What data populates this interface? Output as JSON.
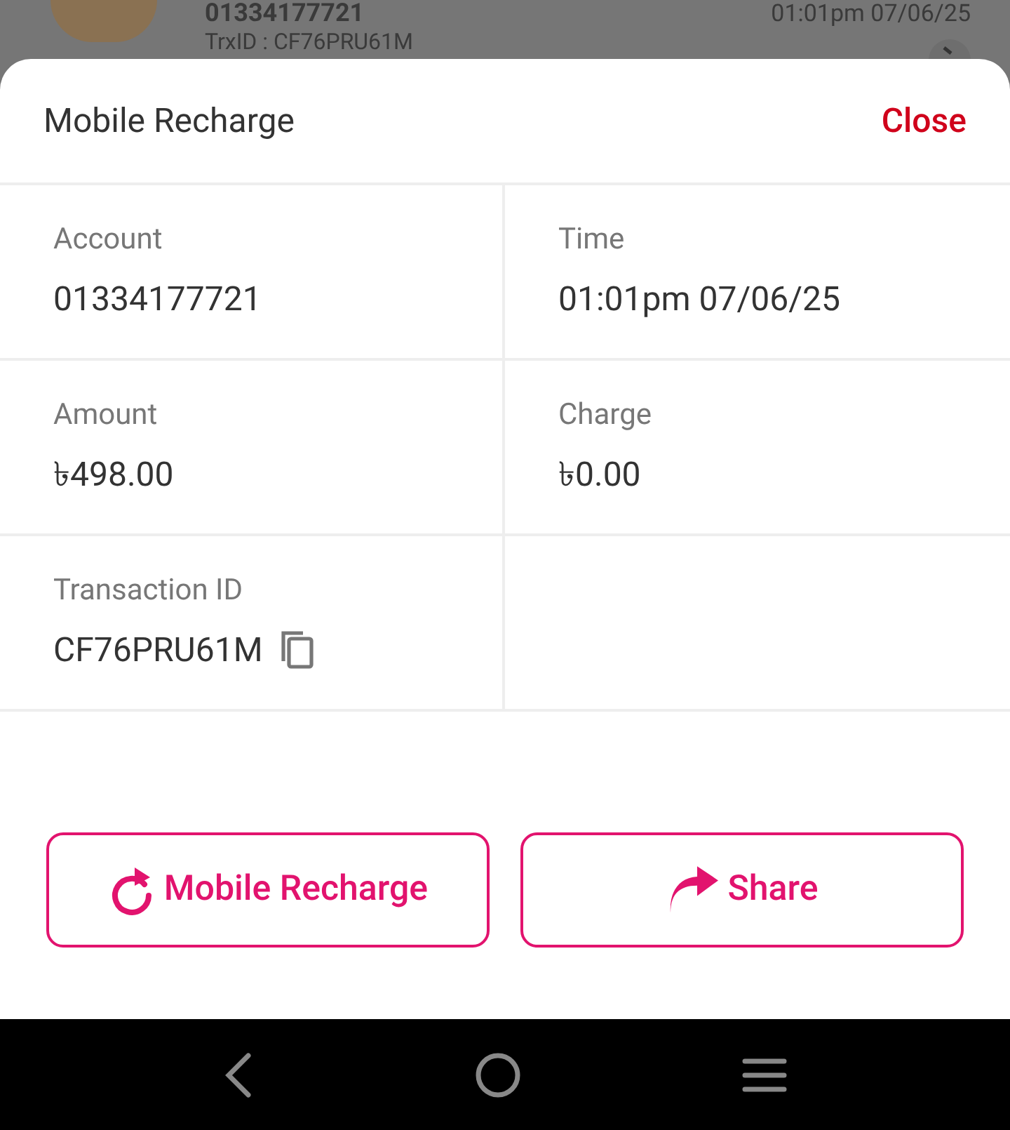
{
  "background_item": {
    "account": "01334177721",
    "time": "01:01pm 07/06/25",
    "trx_id": "TrxID : CF76PRU61M"
  },
  "sheet": {
    "title": "Mobile Recharge",
    "close": "Close"
  },
  "fields": [
    {
      "label": "Account",
      "value": "01334177721",
      "copyable": false
    },
    {
      "label": "Time",
      "value": "01:01pm 07/06/25",
      "copyable": false
    },
    {
      "label": "Amount",
      "value": "৳498.00",
      "copyable": false
    },
    {
      "label": "Charge",
      "value": "৳0.00",
      "copyable": false
    },
    {
      "label": "Transaction ID",
      "value": "CF76PRU61M",
      "copyable": true
    }
  ],
  "actions": [
    {
      "kind": "repeat",
      "label": "Mobile Recharge"
    },
    {
      "kind": "share",
      "label": "Share"
    }
  ]
}
